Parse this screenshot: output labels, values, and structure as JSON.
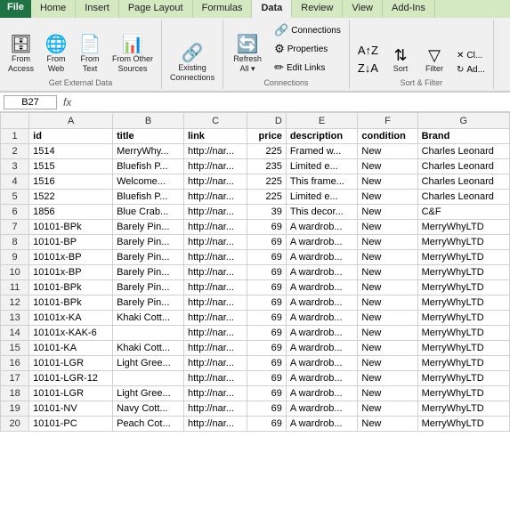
{
  "ribbon": {
    "accent_label": "File",
    "tabs": [
      "Home",
      "Insert",
      "Page Layout",
      "Formulas",
      "Data",
      "Review",
      "View",
      "Add-Ins"
    ],
    "active_tab": "Data",
    "groups": {
      "get_external": {
        "label": "Get External Data",
        "buttons": [
          {
            "id": "from-access",
            "label": "From\nAccess",
            "icon": "🗄"
          },
          {
            "id": "from-web",
            "label": "From\nWeb",
            "icon": "🌐"
          },
          {
            "id": "from-text",
            "label": "From\nText",
            "icon": "📄"
          },
          {
            "id": "from-other",
            "label": "From Other\nSources",
            "icon": "📊"
          }
        ]
      },
      "connections": {
        "label": "Connections",
        "buttons_main": [
          {
            "id": "existing-conn",
            "label": "Existing\nConnections",
            "icon": "🔗"
          }
        ],
        "buttons_right": [
          {
            "id": "connections",
            "label": "Connections",
            "icon": "🔗"
          },
          {
            "id": "properties",
            "label": "Properties",
            "icon": "⚙"
          },
          {
            "id": "edit-links",
            "label": "Edit Links",
            "icon": "✏"
          }
        ]
      },
      "refresh": {
        "label": "",
        "buttons": [
          {
            "id": "refresh-all",
            "label": "Refresh\nAll",
            "icon": "🔄"
          }
        ]
      },
      "sort_filter": {
        "label": "Sort & Filter",
        "buttons": [
          {
            "id": "sort-asc",
            "icon": "↑"
          },
          {
            "id": "sort-desc",
            "icon": "↓"
          },
          {
            "id": "sort",
            "label": "Sort",
            "icon": "⇅"
          },
          {
            "id": "filter",
            "label": "Filter",
            "icon": "▽"
          }
        ]
      }
    }
  },
  "formula_bar": {
    "name_box": "B27",
    "fx": "fx"
  },
  "columns": [
    "",
    "A",
    "B",
    "C",
    "D",
    "E",
    "F",
    "G"
  ],
  "col_headers": [
    "id",
    "title",
    "link",
    "price",
    "description",
    "condition",
    "Brand"
  ],
  "rows": [
    [
      "2",
      "1514",
      "MerryWhy...",
      "http://nar...",
      "225",
      "Framed w...",
      "New",
      "Charles Leonard"
    ],
    [
      "3",
      "1515",
      "Bluefish P...",
      "http://nar...",
      "235",
      "Limited e...",
      "New",
      "Charles Leonard"
    ],
    [
      "4",
      "1516",
      "Welcome...",
      "http://nar...",
      "225",
      "This frame...",
      "New",
      "Charles Leonard"
    ],
    [
      "5",
      "1522",
      "Bluefish P...",
      "http://nar...",
      "225",
      "Limited e...",
      "New",
      "Charles Leonard"
    ],
    [
      "6",
      "1856",
      "Blue Crab...",
      "http://nar...",
      "39",
      "This decor...",
      "New",
      "C&F"
    ],
    [
      "7",
      "10101-BPk",
      "Barely Pin...",
      "http://nar...",
      "69",
      "A wardrob...",
      "New",
      "MerryWhyLTD"
    ],
    [
      "8",
      "10101-BP",
      "Barely Pin...",
      "http://nar...",
      "69",
      "A wardrob...",
      "New",
      "MerryWhyLTD"
    ],
    [
      "9",
      "10101x-BP",
      "Barely Pin...",
      "http://nar...",
      "69",
      "A wardrob...",
      "New",
      "MerryWhyLTD"
    ],
    [
      "10",
      "10101x-BP",
      "Barely Pin...",
      "http://nar...",
      "69",
      "A wardrob...",
      "New",
      "MerryWhyLTD"
    ],
    [
      "11",
      "10101-BPk",
      "Barely Pin...",
      "http://nar...",
      "69",
      "A wardrob...",
      "New",
      "MerryWhyLTD"
    ],
    [
      "12",
      "10101-BPk",
      "Barely Pin...",
      "http://nar...",
      "69",
      "A wardrob...",
      "New",
      "MerryWhyLTD"
    ],
    [
      "13",
      "10101x-KA",
      "Khaki Cott...",
      "http://nar...",
      "69",
      "A wardrob...",
      "New",
      "MerryWhyLTD"
    ],
    [
      "14",
      "10101x-KAK-6",
      "",
      "http://nar...",
      "69",
      "A wardrob...",
      "New",
      "MerryWhyLTD"
    ],
    [
      "15",
      "10101-KA",
      "Khaki Cott...",
      "http://nar...",
      "69",
      "A wardrob...",
      "New",
      "MerryWhyLTD"
    ],
    [
      "16",
      "10101-LGR",
      "Light Gree...",
      "http://nar...",
      "69",
      "A wardrob...",
      "New",
      "MerryWhyLTD"
    ],
    [
      "17",
      "10101-LGR-12",
      "",
      "http://nar...",
      "69",
      "A wardrob...",
      "New",
      "MerryWhyLTD"
    ],
    [
      "18",
      "10101-LGR",
      "Light Gree...",
      "http://nar...",
      "69",
      "A wardrob...",
      "New",
      "MerryWhyLTD"
    ],
    [
      "19",
      "10101-NV",
      "Navy Cott...",
      "http://nar...",
      "69",
      "A wardrob...",
      "New",
      "MerryWhyLTD"
    ],
    [
      "20",
      "10101-PC",
      "Peach Cot...",
      "http://nar...",
      "69",
      "A wardrob...",
      "New",
      "MerryWhyLTD"
    ]
  ]
}
